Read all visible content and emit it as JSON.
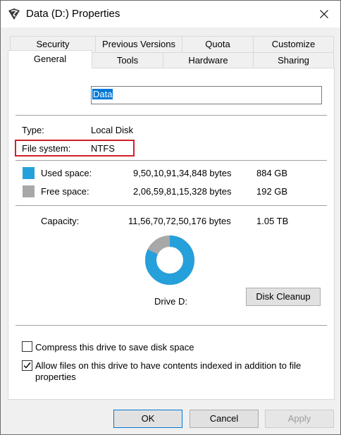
{
  "window": {
    "title": "Data (D:) Properties"
  },
  "tabs": {
    "row1": [
      "Security",
      "Previous Versions",
      "Quota",
      "Customize"
    ],
    "row2": [
      "General",
      "Tools",
      "Hardware",
      "Sharing"
    ],
    "active": "General"
  },
  "general": {
    "drive_name": "Data",
    "type_label": "Type:",
    "type_value": "Local Disk",
    "fs_label": "File system:",
    "fs_value": "NTFS",
    "used_label": "Used space:",
    "used_bytes": "9,50,10,91,34,848 bytes",
    "used_size": "884 GB",
    "free_label": "Free space:",
    "free_bytes": "2,06,59,81,15,328 bytes",
    "free_size": "192 GB",
    "capacity_label": "Capacity:",
    "capacity_bytes": "11,56,70,72,50,176 bytes",
    "capacity_size": "1.05 TB",
    "drive_label": "Drive D:",
    "disk_cleanup_label": "Disk Cleanup",
    "used_fraction": 0.8214,
    "used_color": "#26a0da",
    "free_color": "#a8a8a8",
    "compress_label": "Compress this drive to save disk space",
    "compress_checked": false,
    "index_label_line1": "Allow files on this drive to have contents indexed in addition to file",
    "index_label_line2": "properties",
    "index_checked": true
  },
  "buttons": {
    "ok": "OK",
    "cancel": "Cancel",
    "apply": "Apply"
  }
}
